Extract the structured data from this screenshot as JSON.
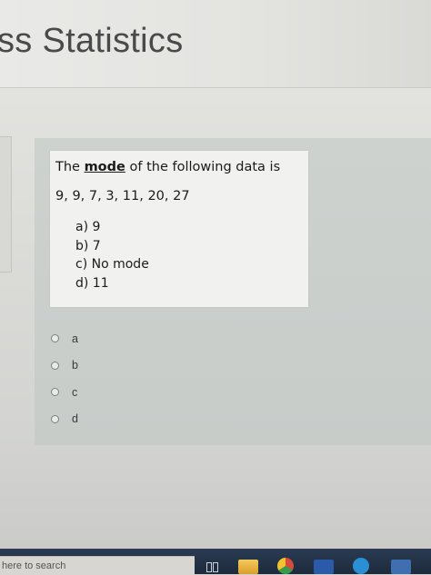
{
  "page": {
    "title": "ss Statistics"
  },
  "question": {
    "intro_before": "The ",
    "keyword": "mode",
    "intro_after": " of the following data is",
    "data": "9, 9, 7, 3, 11, 20, 27",
    "choices": [
      "a)  9",
      "b)  7",
      "c)  No mode",
      "d)  11"
    ]
  },
  "answer_options": [
    {
      "label": "a",
      "selected": false
    },
    {
      "label": "b",
      "selected": false
    },
    {
      "label": "c",
      "selected": false
    },
    {
      "label": "d",
      "selected": false
    }
  ],
  "taskbar": {
    "search_text": "here to search",
    "icons": [
      "task-view-icon",
      "file-explorer-icon",
      "chrome-icon",
      "word-icon",
      "edge-icon",
      "store-icon"
    ]
  },
  "colors": {
    "panel": "#cdd2cf",
    "card": "#f1f1ef",
    "taskbar": "#1d2a3c"
  }
}
